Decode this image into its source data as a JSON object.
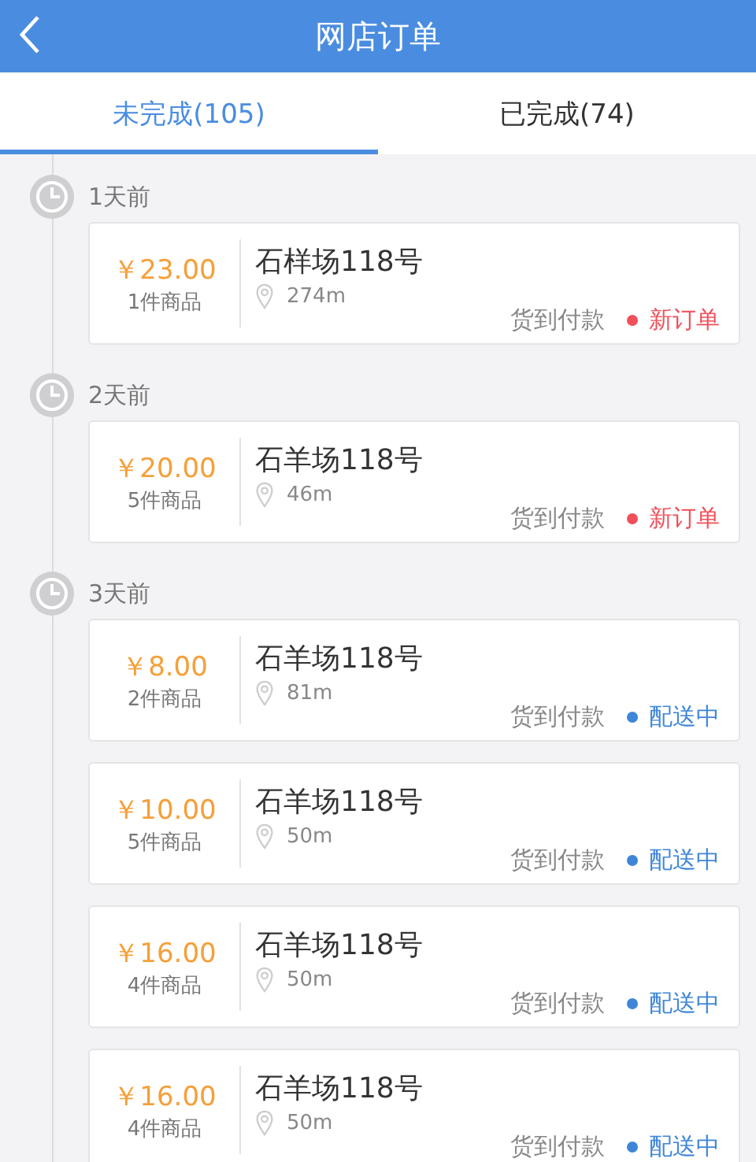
{
  "header": {
    "title": "网店订单"
  },
  "tabs": [
    {
      "label": "未完成(105)",
      "selected": true
    },
    {
      "label": "已完成(74)",
      "selected": false
    }
  ],
  "groups": [
    {
      "date": "1天前",
      "orders": [
        {
          "price": "￥23.00",
          "items": "1件商品",
          "address": "石样场118号",
          "distance": "274m",
          "payment": "货到付款",
          "status": "新订单",
          "color": "#f0505a"
        }
      ]
    },
    {
      "date": "2天前",
      "orders": [
        {
          "price": "￥20.00",
          "items": "5件商品",
          "address": "石羊场118号",
          "distance": "46m",
          "payment": "货到付款",
          "status": "新订单",
          "color": "#f0505a"
        }
      ]
    },
    {
      "date": "3天前",
      "orders": [
        {
          "price": "￥8.00",
          "items": "2件商品",
          "address": "石羊场118号",
          "distance": "81m",
          "payment": "货到付款",
          "status": "配送中",
          "color": "#3f86d9"
        },
        {
          "price": "￥10.00",
          "items": "5件商品",
          "address": "石羊场118号",
          "distance": "50m",
          "payment": "货到付款",
          "status": "配送中",
          "color": "#3f86d9"
        },
        {
          "price": "￥16.00",
          "items": "4件商品",
          "address": "石羊场118号",
          "distance": "50m",
          "payment": "货到付款",
          "status": "配送中",
          "color": "#3f86d9"
        },
        {
          "price": "￥16.00",
          "items": "4件商品",
          "address": "石羊场118号",
          "distance": "50m",
          "payment": "货到付款",
          "status": "配送中",
          "color": "#3f86d9"
        }
      ]
    }
  ]
}
